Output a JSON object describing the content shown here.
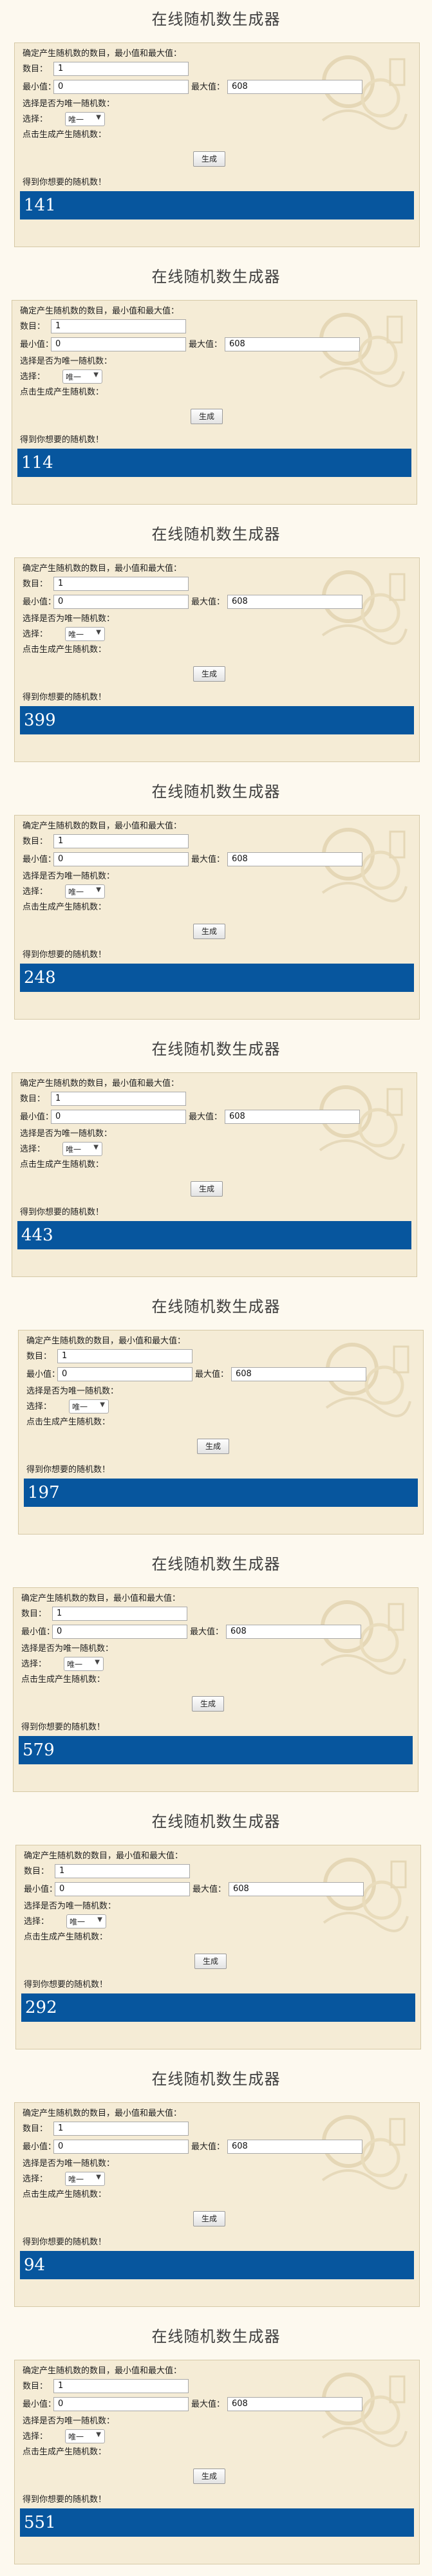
{
  "title": "在线随机数生成器",
  "instructions": "确定产生随机数的数目，最小值和最大值：",
  "count_label": "数目：",
  "count_value": "1",
  "min_label": "最小值：",
  "min_value": "0",
  "max_label": "最大值：",
  "max_value": "608",
  "unique_prompt": "选择是否为唯一随机数：",
  "select_label": "选择：",
  "select_value": "唯一",
  "generate_prompt": "点击生成产生随机数：",
  "generate_label": "生成",
  "result_label": "得到你想要的随机数！",
  "results": [
    "141",
    "114",
    "399",
    "248",
    "443",
    "197",
    "579",
    "292",
    "94",
    "551"
  ]
}
